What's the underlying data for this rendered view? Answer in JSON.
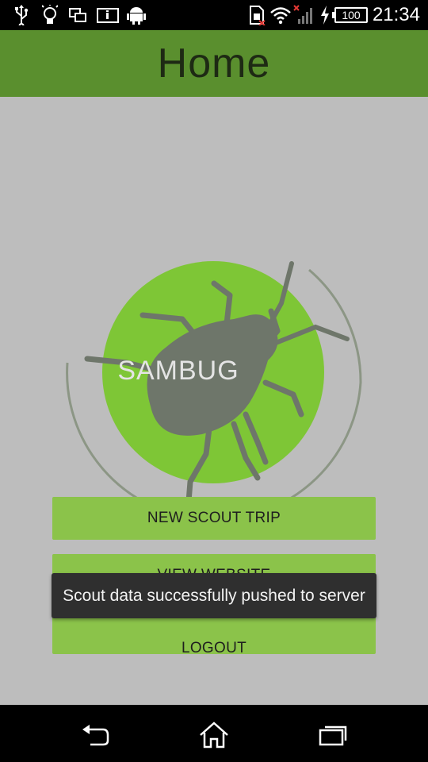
{
  "status_bar": {
    "time": "21:34",
    "battery_level": "100",
    "icons": [
      "usb-icon",
      "lightbulb-icon",
      "screen-mirroring-icon",
      "info-card-icon",
      "android-icon",
      "sim-icon",
      "wifi-icon",
      "signal-icon",
      "charging-icon"
    ]
  },
  "header": {
    "title": "Home",
    "color": "#5a8f2e"
  },
  "logo": {
    "text": "SAMBUG",
    "circle_color": "#7ec636",
    "bug_color": "#6e766a"
  },
  "buttons": {
    "new_scout_trip": "NEW SCOUT TRIP",
    "view_website": "VIEW WEBSITE",
    "logout": "LOGOUT",
    "color": "#8bc34a"
  },
  "toast": {
    "message": "Scout data successfully pushed to server"
  },
  "nav_bar": {
    "icons": [
      "back-icon",
      "home-icon",
      "recent-apps-icon"
    ]
  }
}
